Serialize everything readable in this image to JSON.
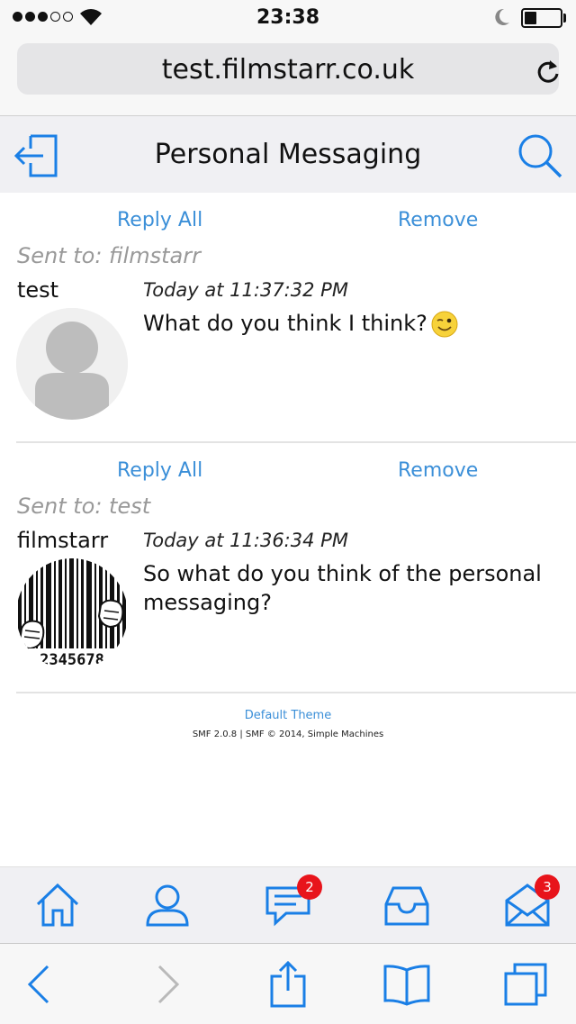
{
  "status_bar": {
    "time": "23:38",
    "signal_bars": 3,
    "signal_total": 5,
    "battery_level": 0.35
  },
  "browser": {
    "url": "test.filmstarr.co.uk",
    "reload_icon": "reload-icon"
  },
  "header": {
    "title": "Personal Messaging",
    "left_icon": "logout-icon",
    "right_icon": "search-icon"
  },
  "messages": [
    {
      "reply_label": "Reply All",
      "remove_label": "Remove",
      "sent_to": "Sent to: filmstarr",
      "author": "test",
      "date": "Today at 11:37:32 PM",
      "body": "What do you think I think?",
      "emoji": "wink-emoji-icon",
      "avatar": "default-avatar-icon"
    },
    {
      "reply_label": "Reply All",
      "remove_label": "Remove",
      "sent_to": "Sent to: test",
      "author": "filmstarr",
      "date": "Today at 11:36:34 PM",
      "body": "So what do you think of the personal messaging?",
      "avatar": "barcode-avatar-image",
      "avatar_digits": "2345678"
    }
  ],
  "footer": {
    "theme": "Default Theme",
    "copyright": "SMF 2.0.8 | SMF © 2014, Simple Machines"
  },
  "app_bar": {
    "items": [
      {
        "icon": "home-icon"
      },
      {
        "icon": "profile-icon"
      },
      {
        "icon": "messages-icon",
        "badge": "2"
      },
      {
        "icon": "inbox-icon"
      },
      {
        "icon": "mail-icon",
        "badge": "3"
      }
    ]
  },
  "toolbar": {
    "items": [
      "back-icon",
      "forward-icon",
      "share-icon",
      "bookmarks-icon",
      "tabs-icon"
    ]
  },
  "colors": {
    "accent": "#1a7fe6",
    "link": "#3b8fd8",
    "badge": "#e8141b",
    "muted_text": "#999999"
  }
}
